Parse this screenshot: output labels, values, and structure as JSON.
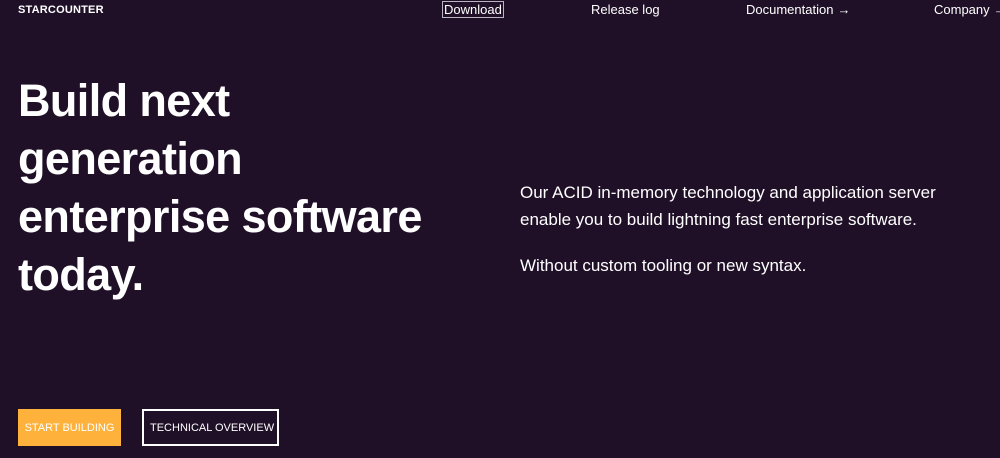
{
  "brand": {
    "logo_text": "STARCOUNTER"
  },
  "nav": {
    "download": "Download",
    "release_log": "Release log",
    "documentation": "Documentation",
    "company": "Company",
    "arrow": "→"
  },
  "hero": {
    "title_line1": "Build next",
    "title_line2": "generation",
    "title_line3": "enterprise software",
    "title_line4": "today.",
    "copy_1": "Our ACID in-memory technology and application server enable you to build lightning fast enterprise software.",
    "copy_2": "Without custom tooling or new syntax."
  },
  "cta": {
    "primary": "START BUILDING",
    "secondary": "TECHNICAL OVERVIEW"
  },
  "colors": {
    "background": "#1f1027",
    "accent": "#ffb23b",
    "text": "#ffffff"
  }
}
